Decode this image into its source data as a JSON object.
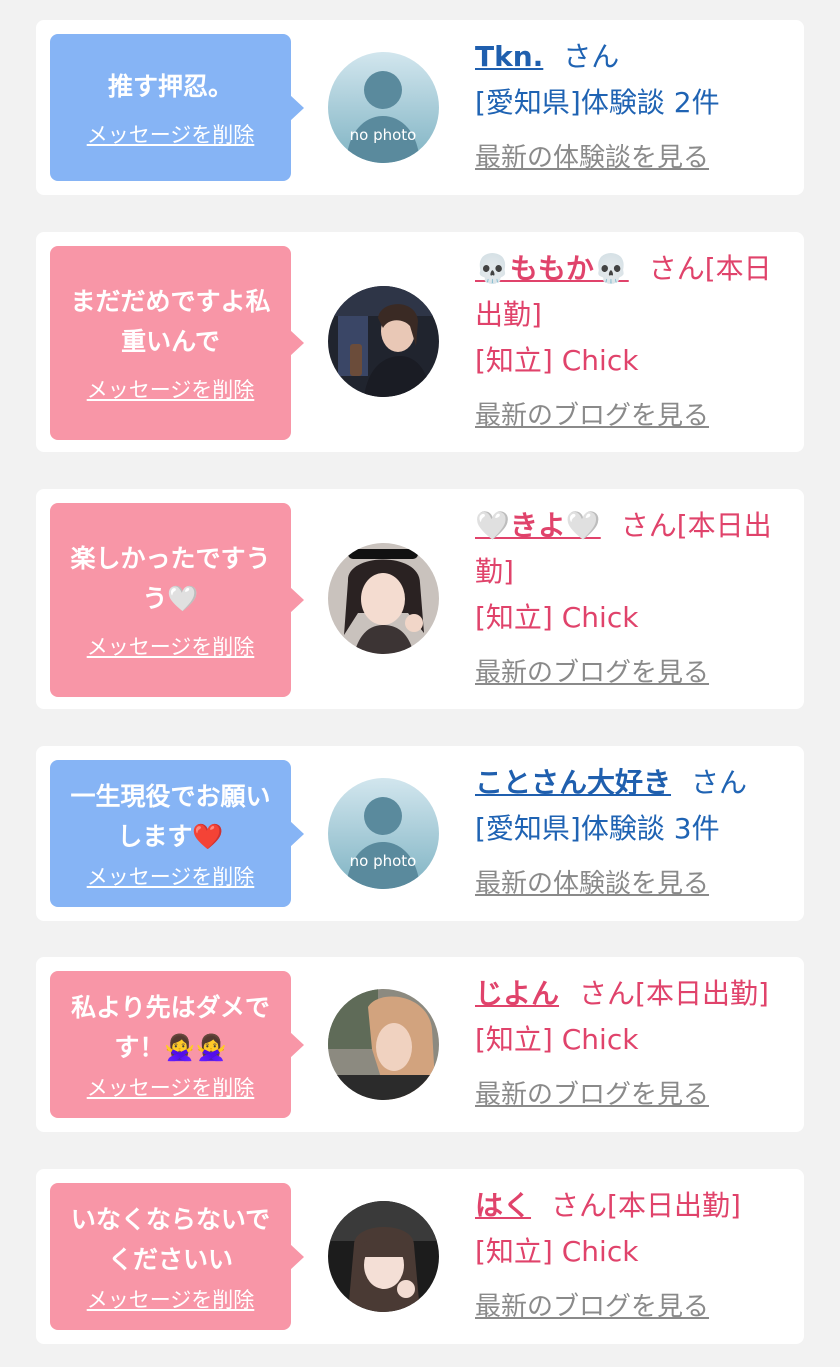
{
  "cards": [
    {
      "message": "推す押忍。",
      "delete_label": "メッセージを削除",
      "name": "Tkn.",
      "san": "さん",
      "meta": "[愛知県]体験談 2件",
      "latest": "最新の体験談を見る",
      "avatar": "no photo"
    },
    {
      "message": "まだだめですよ私重いんで",
      "delete_label": "メッセージを削除",
      "name": "💀ももか💀",
      "san": "さん[本日出勤]",
      "meta": "[知立] Chick",
      "latest": "最新のブログを見る"
    },
    {
      "message": "楽しかったですうう🤍",
      "delete_label": "メッセージを削除",
      "name": "🤍きよ🤍",
      "san": "さん[本日出勤]",
      "meta": "[知立] Chick",
      "latest": "最新のブログを見る"
    },
    {
      "message": "一生現役でお願いします❤️",
      "delete_label": "メッセージを削除",
      "name": "ことさん大好き",
      "san": "さん",
      "meta": "[愛知県]体験談 3件",
      "latest": "最新の体験談を見る",
      "avatar": "no photo"
    },
    {
      "message": "私より先はダメです！🙅‍♀️🙅‍♀️",
      "delete_label": "メッセージを削除",
      "name": "じよん",
      "san": "さん[本日出勤]",
      "meta": "[知立] Chick",
      "latest": "最新のブログを見る"
    },
    {
      "message": "いなくならないでくださいい",
      "delete_label": "メッセージを削除",
      "name": "はく",
      "san": "さん[本日出勤]",
      "meta": "[知立] Chick",
      "latest": "最新のブログを見る"
    }
  ],
  "colors": {
    "page_bg": "#f2f2f2",
    "bubble_blue": "#86b4f5",
    "bubble_pink": "#f896a7",
    "text_blue": "#1f63b3",
    "text_pink": "#e0436b",
    "link_gray": "#8a8a8a"
  }
}
